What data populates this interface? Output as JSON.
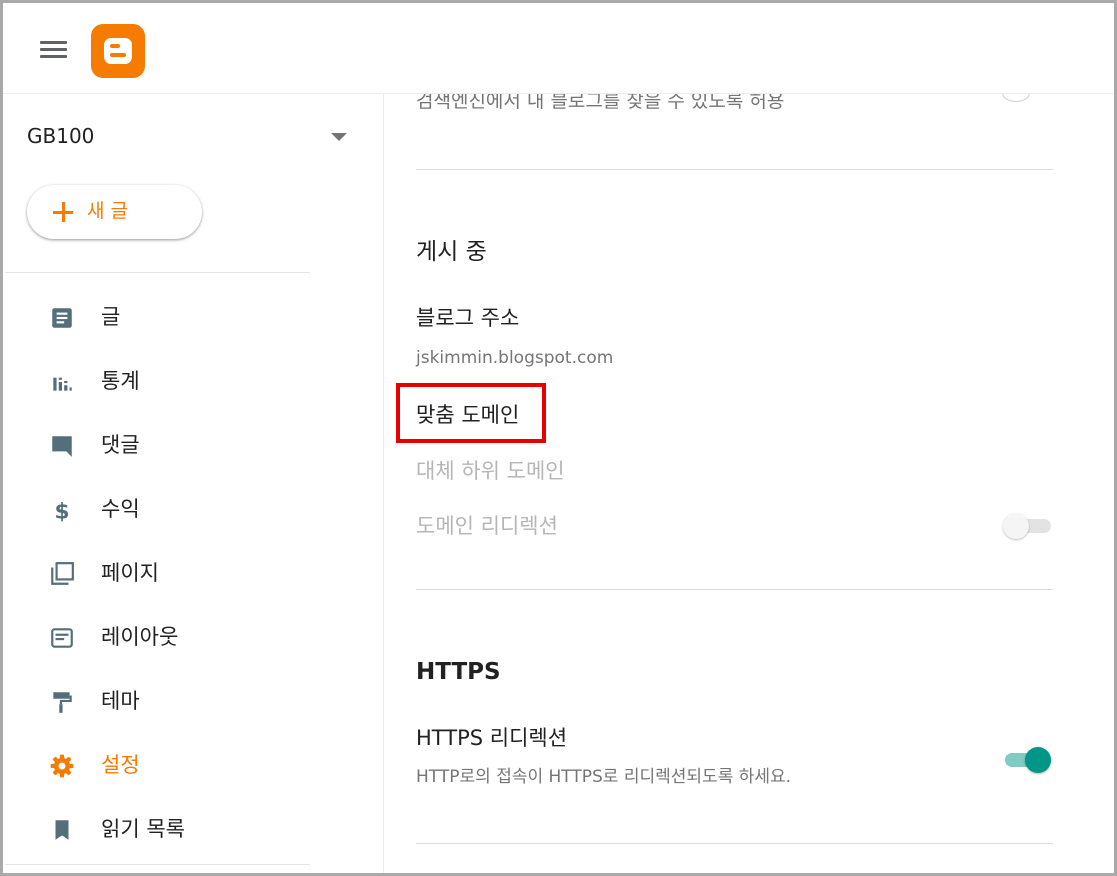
{
  "header": {
    "menu_icon": "hamburger-menu-icon",
    "logo_icon": "blogger-logo-icon",
    "brand_color": "#f57c00"
  },
  "sidebar": {
    "blog_name": "GB100",
    "new_post_label": "새 글",
    "items": [
      {
        "label": "글",
        "icon": "posts-icon"
      },
      {
        "label": "통계",
        "icon": "stats-icon"
      },
      {
        "label": "댓글",
        "icon": "comments-icon"
      },
      {
        "label": "수익",
        "icon": "earnings-icon"
      },
      {
        "label": "페이지",
        "icon": "pages-icon"
      },
      {
        "label": "레이아웃",
        "icon": "layout-icon"
      },
      {
        "label": "테마",
        "icon": "theme-icon"
      },
      {
        "label": "설정",
        "icon": "settings-icon",
        "active": true
      },
      {
        "label": "읽기 목록",
        "icon": "reading-list-icon"
      }
    ]
  },
  "main": {
    "search_visibility_text": "검색엔진에서 내 블로그를 찾을 수 있도록 허용",
    "publishing": {
      "title": "게시 중",
      "blog_address_label": "블로그 주소",
      "blog_address_value": "jskimmin.blogspot.com",
      "custom_domain_label": "맞춤 도메인",
      "fallback_subdomain_label": "대체 하위 도메인",
      "domain_redirect_label": "도메인 리디렉션",
      "domain_redirect_enabled": false
    },
    "https": {
      "title": "HTTPS",
      "redirect_label": "HTTPS 리디렉션",
      "redirect_desc": "HTTP로의 접속이 HTTPS로 리디렉션되도록 하세요.",
      "redirect_enabled": true
    }
  },
  "colors": {
    "accent": "#f57c00",
    "toggle_on": "#009688",
    "highlight": "#e60000",
    "icon_gray": "#546e7a"
  }
}
